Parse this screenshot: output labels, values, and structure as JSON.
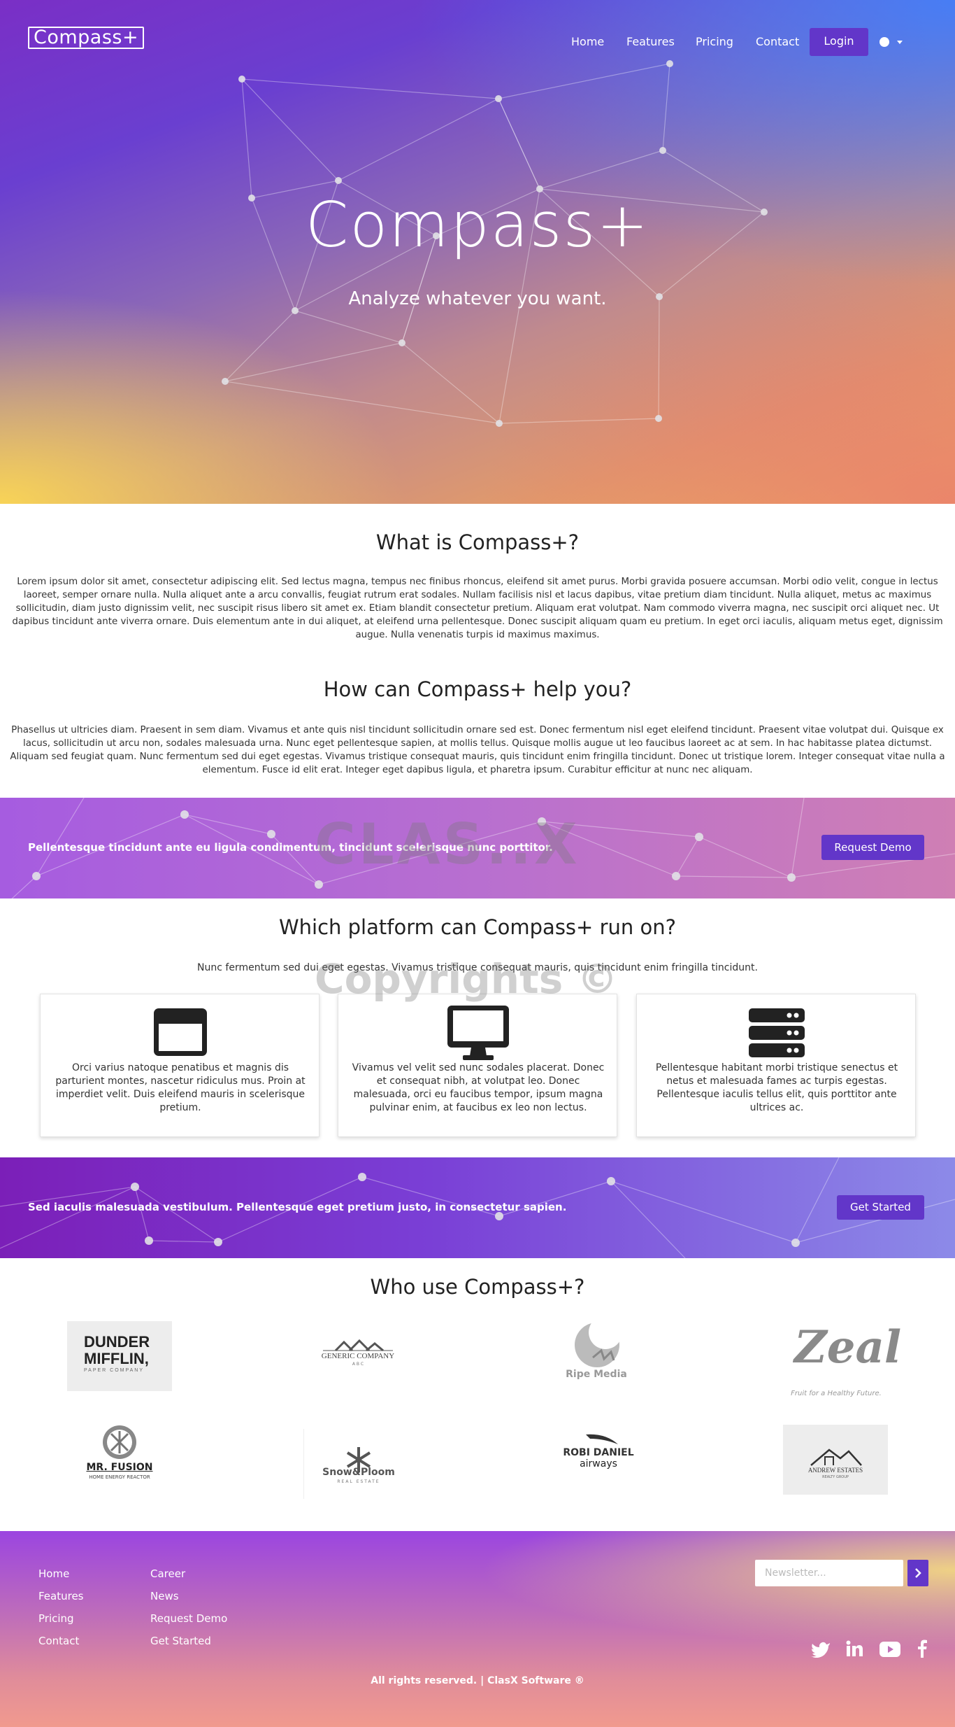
{
  "nav": {
    "logo": "Compass+",
    "home": "Home",
    "features": "Features",
    "pricing": "Pricing",
    "contact": "Contact",
    "login": "Login"
  },
  "hero": {
    "title": "Compass+",
    "subtitle": "Analyze whatever you want."
  },
  "about": {
    "title": "What is Compass+?",
    "body": "Lorem ipsum dolor sit amet, consectetur adipiscing elit. Sed lectus magna, tempus nec finibus rhoncus, eleifend sit amet purus. Morbi gravida posuere accumsan. Morbi odio velit, congue in lectus laoreet, semper ornare nulla. Nulla aliquet ante a arcu convallis, feugiat rutrum erat sodales. Nullam facilisis nisl et lacus dapibus, vitae pretium diam tincidunt. Nulla aliquet, metus ac maximus sollicitudin, diam justo dignissim velit, nec suscipit risus libero sit amet ex. Etiam blandit consectetur pretium. Aliquam erat volutpat. Nam commodo viverra magna, nec suscipit orci aliquet nec. Ut dapibus tincidunt ante viverra ornare. Duis elementum ante in dui aliquet, at eleifend urna pellentesque. Donec suscipit aliquam quam eu pretium. In eget orci iaculis, aliquam metus eget, dignissim augue. Nulla venenatis turpis id maximus maximus."
  },
  "help": {
    "title": "How can Compass+ help you?",
    "body": "Phasellus ut ultricies diam. Praesent in sem diam. Vivamus et ante quis nisl tincidunt sollicitudin ornare sed est. Donec fermentum nisl eget eleifend tincidunt. Praesent vitae volutpat dui. Quisque ex lacus, sollicitudin ut arcu non, sodales malesuada urna. Nunc eget pellentesque sapien, at mollis tellus. Quisque mollis augue ut leo faucibus laoreet ac at sem. In hac habitasse platea dictumst. Aliquam sed feugiat quam. Nunc fermentum sed dui eget egestas. Vivamus tristique consequat mauris, quis tincidunt enim fringilla tincidunt. Donec ut tristique lorem. Integer consequat vitae nulla a elementum. Fusce id elit erat. Integer eget dapibus ligula, et pharetra ipsum. Curabitur efficitur at nunc nec aliquam."
  },
  "band1": {
    "text": "Pellentesque tincidunt ante eu ligula condimentum, tincidunt scelerisque nunc porttitor.",
    "button": "Request Demo"
  },
  "platforms": {
    "title": "Which platform can Compass+ run on?",
    "subtitle": "Nunc fermentum sed dui eget egestas. Vivamus tristique consequat mauris, quis tincidunt enim fringilla tincidunt.",
    "cards": [
      {
        "icon": "browser-window-icon",
        "text": "Orci varius natoque penatibus et magnis dis parturient montes, nascetur ridiculus mus. Proin at imperdiet velit. Duis eleifend mauris in scelerisque pretium."
      },
      {
        "icon": "desktop-monitor-icon",
        "text": "Vivamus vel velit sed nunc sodales placerat. Donec et consequat nibh, at volutpat leo. Donec malesuada, orci eu faucibus tempor, ipsum magna pulvinar enim, at faucibus ex leo non lectus."
      },
      {
        "icon": "server-icon",
        "text": "Pellentesque habitant morbi tristique senectus et netus et malesuada fames ac turpis egestas. Pellentesque iaculis tellus elit, quis porttitor ante ultrices ac."
      }
    ]
  },
  "band2": {
    "text": "Sed iaculis malesuada vestibulum. Pellentesque eget pretium justo, in consectetur sapien.",
    "button": "Get Started"
  },
  "clients": {
    "title": "Who use Compass+?",
    "logos": {
      "dunder1": "DUNDER",
      "dunder2": "MIFFLIN,",
      "dunder3": "PAPER COMPANY",
      "generic": "GENERIC COMPANY",
      "generic_sub": "A B C",
      "ripe": "Ripe Media",
      "zeal": "Zeal",
      "zeal_sub": "Fruit for a Healthy Future.",
      "fusion": "MR. FUSION",
      "fusion_sub": "HOME ENERGY REACTOR",
      "snow": "Snow&Ploom",
      "snow_sub": "REAL ESTATE",
      "robi1": "ROBI DANIEL",
      "robi2": "airways",
      "andrew": "ANDREW ESTATES",
      "andrew_sub": "REALTY GROUP"
    }
  },
  "footer": {
    "col1": [
      "Home",
      "Features",
      "Pricing",
      "Contact"
    ],
    "col2": [
      "Career",
      "News",
      "Request Demo",
      "Get Started"
    ],
    "newsletter_placeholder": "Newsletter...",
    "copyright": "All rights reserved. | ClasX Software ®"
  },
  "watermark": {
    "line1": "CLAS..X",
    "line2": "Copyrights ©"
  },
  "colors": {
    "accent": "#6236c9"
  }
}
